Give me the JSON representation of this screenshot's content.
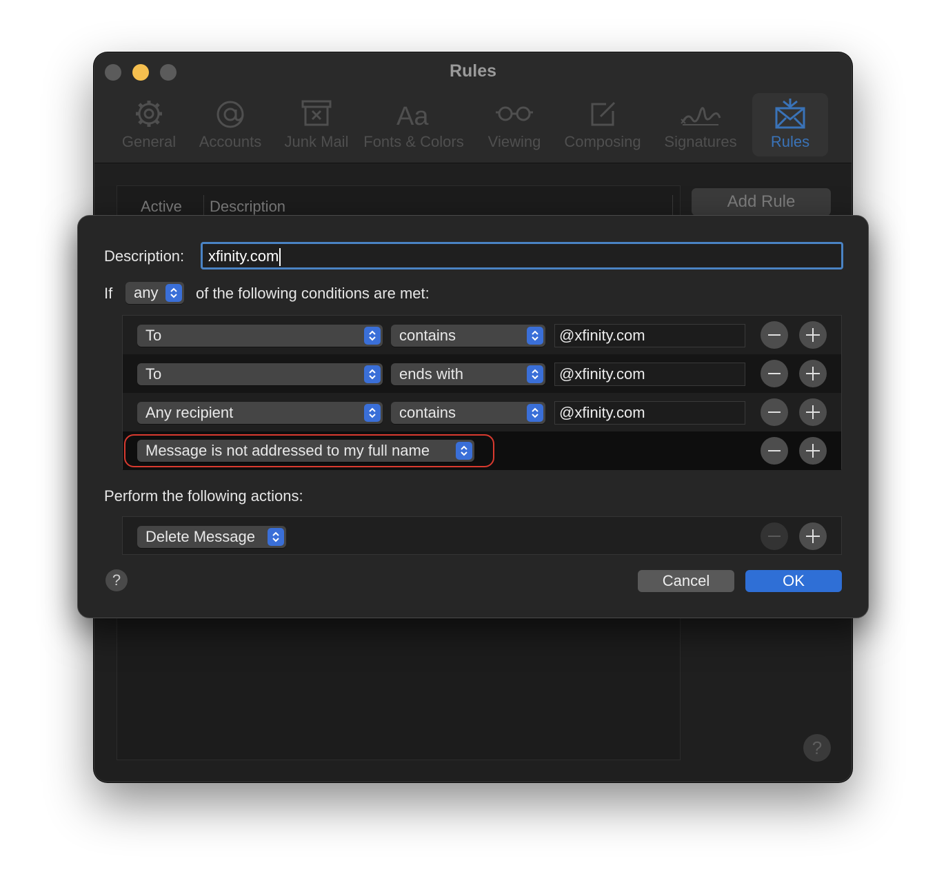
{
  "window": {
    "title": "Rules",
    "tabs": [
      {
        "label": "General",
        "icon": "gear-icon"
      },
      {
        "label": "Accounts",
        "icon": "at-icon"
      },
      {
        "label": "Junk Mail",
        "icon": "junk-icon"
      },
      {
        "label": "Fonts & Colors",
        "icon": "fonts-icon"
      },
      {
        "label": "Viewing",
        "icon": "glasses-icon"
      },
      {
        "label": "Composing",
        "icon": "compose-icon"
      },
      {
        "label": "Signatures",
        "icon": "signature-icon"
      },
      {
        "label": "Rules",
        "icon": "rules-icon"
      }
    ],
    "active_tab": "Rules",
    "columns": {
      "active": "Active",
      "description": "Description"
    },
    "add_rule": "Add Rule",
    "help": "?"
  },
  "sheet": {
    "description_label": "Description:",
    "description_value": "xfinity.com",
    "if_label": "If",
    "match_value": "any",
    "conditions_suffix": "of the following conditions are met:",
    "conditions": [
      {
        "field": "To",
        "operator": "contains",
        "value": "@xfinity.com"
      },
      {
        "field": "To",
        "operator": "ends with",
        "value": "@xfinity.com"
      },
      {
        "field": "Any recipient",
        "operator": "contains",
        "value": "@xfinity.com"
      },
      {
        "field": "Message is not addressed to my full name"
      }
    ],
    "actions_label": "Perform the following actions:",
    "actions": [
      {
        "action": "Delete Message"
      }
    ],
    "help": "?",
    "cancel": "Cancel",
    "ok": "OK"
  },
  "colors": {
    "accent": "#2f6fd6",
    "highlight": "#d93a2f",
    "traffic_min": "#f5bf4f"
  }
}
